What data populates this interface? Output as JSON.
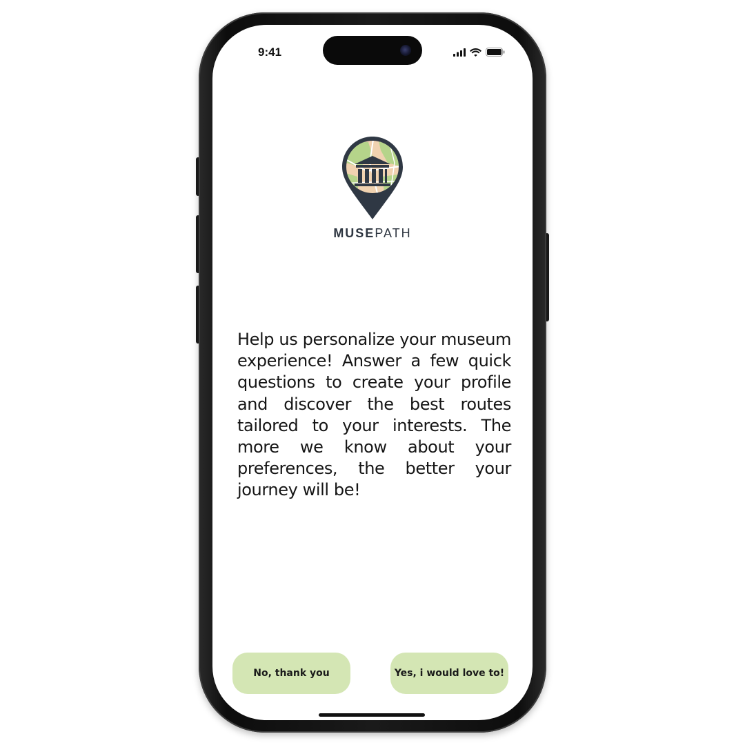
{
  "status_bar": {
    "time": "9:41",
    "icons": [
      "cellular-signal-icon",
      "wifi-icon",
      "battery-icon"
    ]
  },
  "brand": {
    "logo_icon": "museum-map-pin-icon",
    "name_bold": "MUSE",
    "name_light": "PATH"
  },
  "intro": {
    "text": "Help us personalize your museum experience! Answer a few quick questions to create your profile and discover the best routes tailored to your interests. The more we know about your preferences, the better your journey will be!"
  },
  "actions": {
    "decline_label": "No, thank you",
    "accept_label": "Yes, i would love to!"
  },
  "colors": {
    "button_bg": "#d4e6b4",
    "pin_dark": "#2f3844",
    "map_green": "#b5d48a",
    "map_sand": "#f0d2b0"
  }
}
